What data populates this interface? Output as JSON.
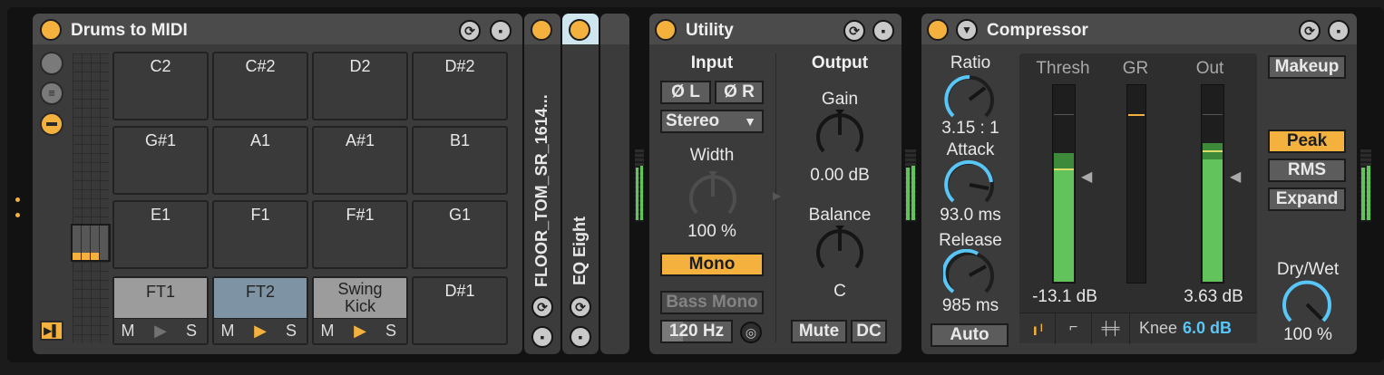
{
  "drum_rack": {
    "title": "Drums to MIDI",
    "pads": [
      {
        "note": "C2"
      },
      {
        "note": "C#2"
      },
      {
        "note": "D2"
      },
      {
        "note": "D#2"
      },
      {
        "note": "G#1"
      },
      {
        "note": "A1"
      },
      {
        "note": "A#1"
      },
      {
        "note": "B1"
      },
      {
        "note": "E1"
      },
      {
        "note": "F1"
      },
      {
        "note": "F#1"
      },
      {
        "note": "G1"
      }
    ],
    "filled_pads": [
      {
        "name": "FT1",
        "m": "M",
        "play": "▶",
        "s": "S"
      },
      {
        "name": "FT2",
        "m": "M",
        "play": "▶",
        "s": "S"
      },
      {
        "name": "Swing Kick",
        "line1": "Swing",
        "line2": "Kick",
        "m": "M",
        "play": "▶",
        "s": "S"
      }
    ],
    "empty_pad": "D#1"
  },
  "chain": {
    "item1": "FLOOR_TOM_SR_1614...",
    "item2": "EQ Eight"
  },
  "utility": {
    "title": "Utility",
    "input_header": "Input",
    "output_header": "Output",
    "phase_left": "Ø L",
    "phase_right": "Ø R",
    "channel_mode": "Stereo",
    "width_label": "Width",
    "width_value": "100 %",
    "mono": "Mono",
    "bass_mono": "Bass Mono",
    "bass_freq": "120 Hz",
    "gain_label": "Gain",
    "gain_value": "0.00 dB",
    "balance_label": "Balance",
    "balance_value": "C",
    "mute": "Mute",
    "dc": "DC"
  },
  "compressor": {
    "title": "Compressor",
    "ratio_label": "Ratio",
    "ratio_value": "3.15 : 1",
    "attack_label": "Attack",
    "attack_value": "93.0 ms",
    "release_label": "Release",
    "release_value": "985 ms",
    "auto": "Auto",
    "thresh_label": "Thresh",
    "gr_label": "GR",
    "out_label": "Out",
    "thresh_value": "-13.1 dB",
    "out_value": "3.63 dB",
    "knee_label": "Knee",
    "knee_value": "6.0 dB",
    "makeup": "Makeup",
    "peak": "Peak",
    "rms": "RMS",
    "expand": "Expand",
    "drywet_label": "Dry/Wet",
    "drywet_value": "100 %",
    "thresh_meter_level": 0.65,
    "out_meter_level": 0.7
  },
  "colors": {
    "accent": "#f4b13d",
    "meter": "#62c35d",
    "value_blue": "#59c6f8"
  }
}
